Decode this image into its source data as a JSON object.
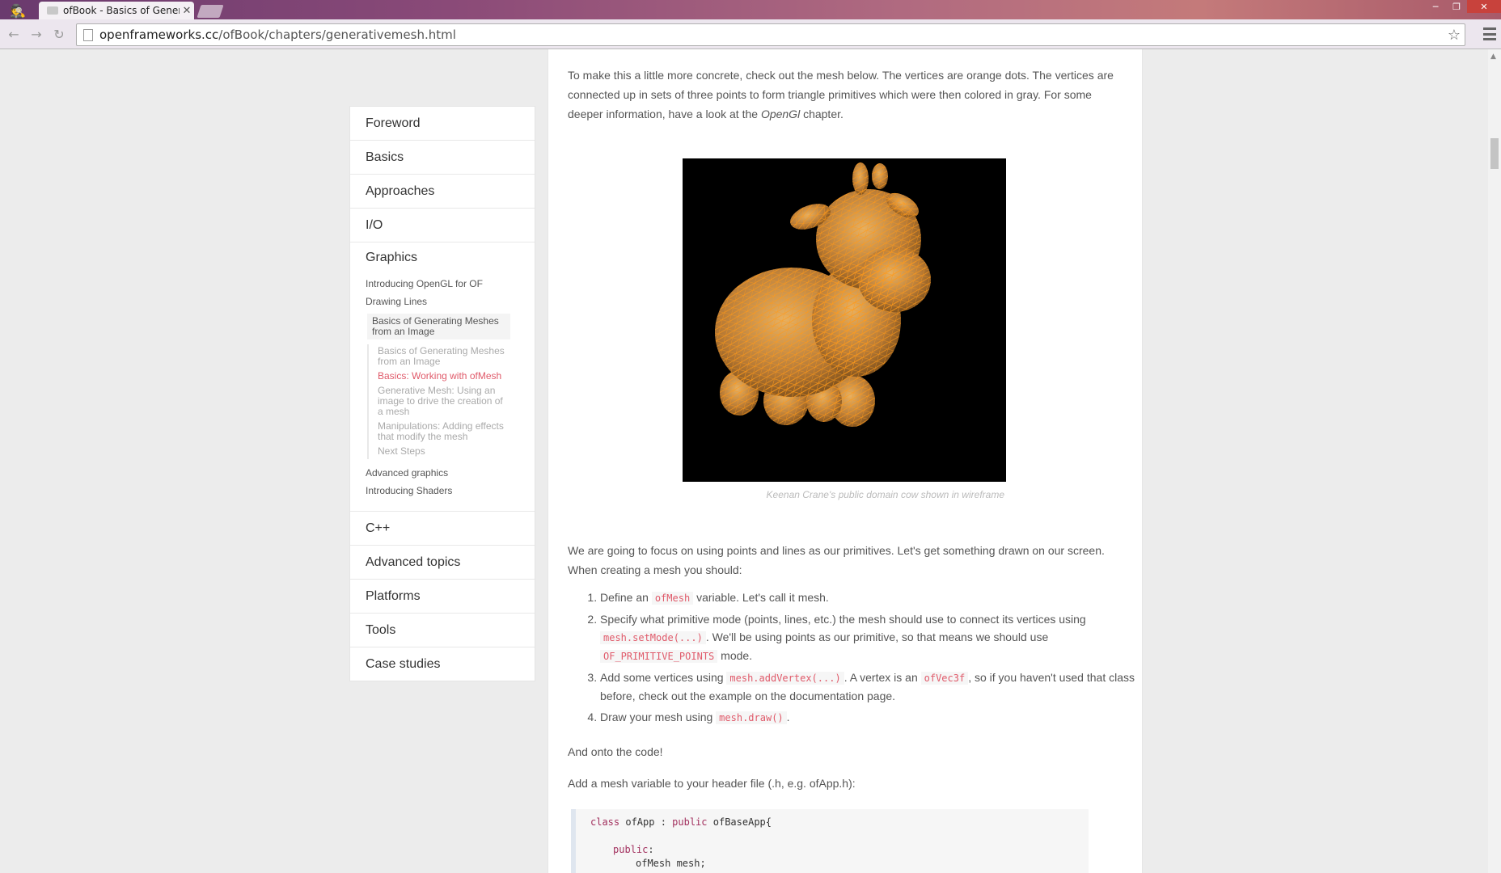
{
  "browser": {
    "tab_title": "ofBook - Basics of Genera",
    "url_host": "openframeworks.cc",
    "url_path": "/ofBook/chapters/generativemesh.html"
  },
  "sidebar": {
    "items_top": [
      "Foreword",
      "Basics",
      "Approaches",
      "I/O"
    ],
    "graphics": {
      "label": "Graphics",
      "links": [
        "Introducing OpenGL for OF",
        "Drawing Lines"
      ],
      "active": "Basics of Generating Meshes from an Image",
      "subsections": [
        "Basics of Generating Meshes from an Image",
        "Basics: Working with ofMesh",
        "Generative Mesh: Using an image to drive the creation of a mesh",
        "Manipulations: Adding effects that modify the mesh",
        "Next Steps"
      ],
      "links_after": [
        "Advanced graphics",
        "Introducing Shaders"
      ]
    },
    "items_bottom": [
      "C++",
      "Advanced topics",
      "Platforms",
      "Tools",
      "Case studies"
    ]
  },
  "article": {
    "intro_pre": "To make this a little more concrete, check out the mesh below. The vertices are orange dots. The vertices are connected up in sets of three points to form triangle primitives which were then colored in gray. For some deeper information, have a look at the ",
    "intro_em": "OpenGl",
    "intro_post": " chapter.",
    "caption": "Keenan Crane's public domain cow shown in wireframe",
    "focus": "We are going to focus on using points and lines as our primitives. Let's get something drawn on our screen. When creating a mesh you should:",
    "steps": {
      "s1_a": "Define an ",
      "s1_code": "ofMesh",
      "s1_b": " variable. Let's call it mesh.",
      "s2_a": "Specify what primitive mode (points, lines, etc.) the mesh should use to connect its vertices using ",
      "s2_code1": "mesh.setMode(...)",
      "s2_b": ". We'll be using points as our primitive, so that means we should use ",
      "s2_code2": "OF_PRIMITIVE_POINTS",
      "s2_c": " mode.",
      "s3_a": "Add some vertices using ",
      "s3_code1": "mesh.addVertex(...)",
      "s3_b": ". A vertex is an ",
      "s3_code2": "ofVec3f",
      "s3_c": ", so if you haven't used that class before, check out the example on the documentation page.",
      "s4_a": "Draw your mesh using ",
      "s4_code": "mesh.draw()",
      "s4_b": "."
    },
    "onto": "And onto the code!",
    "add_mesh": "Add a mesh variable to your header file (.h, e.g. ofApp.h):",
    "code": {
      "l1_kw1": "class",
      "l1_name": " ofApp : ",
      "l1_kw2": "public",
      "l1_rest": " ofBaseApp{",
      "l2_kw": "public",
      "l2_rest": ":",
      "l3": "ofMesh mesh;",
      "l4": "//"
    }
  },
  "colors": {
    "accent": "#e05a6a",
    "wire": "#ff9a1a",
    "cow": "#c98a3a"
  }
}
